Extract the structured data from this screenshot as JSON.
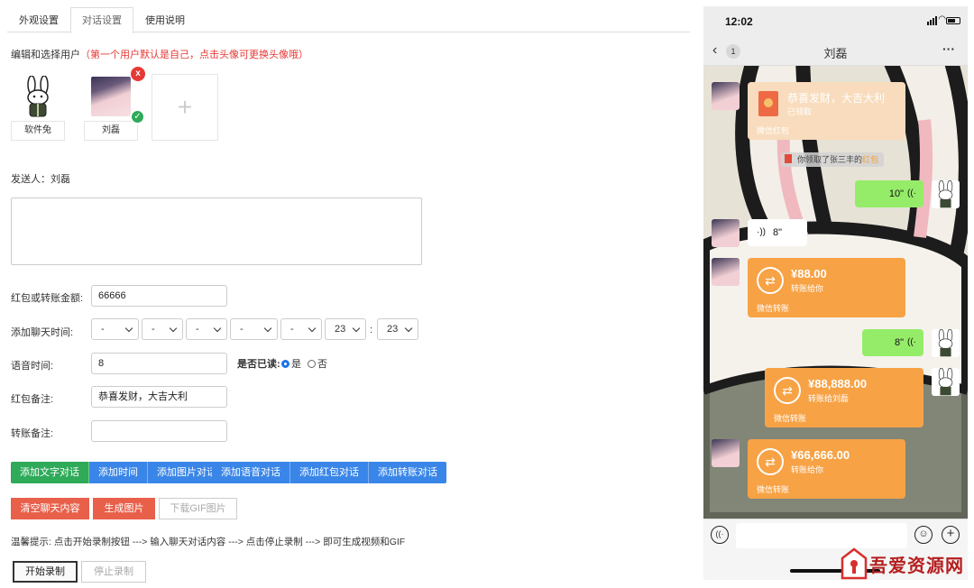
{
  "tabs": [
    "外观设置",
    "对话设置",
    "使用说明"
  ],
  "active_tab": "对话设置",
  "edit_hint": {
    "prefix": "编辑和选择用户",
    "red": "（第一个用户默认是自己，点击头像可更换头像哦）"
  },
  "users": [
    {
      "name": "软件兔"
    },
    {
      "name": "刘磊",
      "delete_badge": "x",
      "selected_badge": "✓"
    }
  ],
  "add_symbol": "+",
  "sender": "发送人：刘磊",
  "form": {
    "amount_label": "红包或转账金额:",
    "amount_value": "66666",
    "time_label": "添加聊天时间:",
    "time_selects": [
      "-",
      "-",
      "-",
      "-",
      "-",
      "23",
      "23"
    ],
    "time_sep": ":",
    "voice_label": "语音时间:",
    "voice_value": "8",
    "read_label": "是否已读:",
    "read_yes": "是",
    "read_no": "否",
    "redpacket_note_label": "红包备注:",
    "redpacket_note_value": "恭喜发财，大吉大利",
    "transfer_note_label": "转账备注:",
    "transfer_note_value": ""
  },
  "buttons_group1": [
    "添加文字对话",
    "添加时间",
    "添加图片对话"
  ],
  "buttons_group2": [
    "添加语音对话",
    "添加红包对话",
    "添加转账对话"
  ],
  "clear_button": "清空聊天内容",
  "generate_button": "生成图片",
  "gif_button": "下载GIF图片",
  "tip": "温馨提示: 点击开始录制按钮 ---> 输入聊天对话内容 ---> 点击停止录制 ---> 即可生成视频和GIF",
  "start_record": "开始录制",
  "stop_record": "停止录制",
  "phone": {
    "time": "12:02",
    "back_count": "1",
    "title": "刘磊",
    "more": "···",
    "messages": [
      {
        "type": "redpacket",
        "text": "恭喜发财，大吉大利",
        "status": "已领取",
        "footer": "微信红包"
      },
      {
        "type": "system",
        "text": "你领取了张三丰的",
        "highlight": "红包"
      },
      {
        "type": "voice-right",
        "duration": "10\""
      },
      {
        "type": "voice-left",
        "duration": "8\""
      },
      {
        "type": "transfer-left",
        "amount": "¥88.00",
        "sub": "转账给你",
        "footer": "微信转账"
      },
      {
        "type": "voice-right",
        "duration": "8\""
      },
      {
        "type": "transfer-right",
        "amount": "¥88,888.00",
        "sub": "转账给刘磊",
        "footer": "微信转账"
      },
      {
        "type": "transfer-left",
        "amount": "¥66,666.00",
        "sub": "转账给你",
        "footer": "微信转账"
      }
    ]
  },
  "watermark": "吾爱资源网",
  "colors": {
    "green": "#2eaa59",
    "blue": "#3a86e8",
    "red": "#e8604a",
    "orange": "#f7a245",
    "wechat_green": "#95ec69"
  }
}
